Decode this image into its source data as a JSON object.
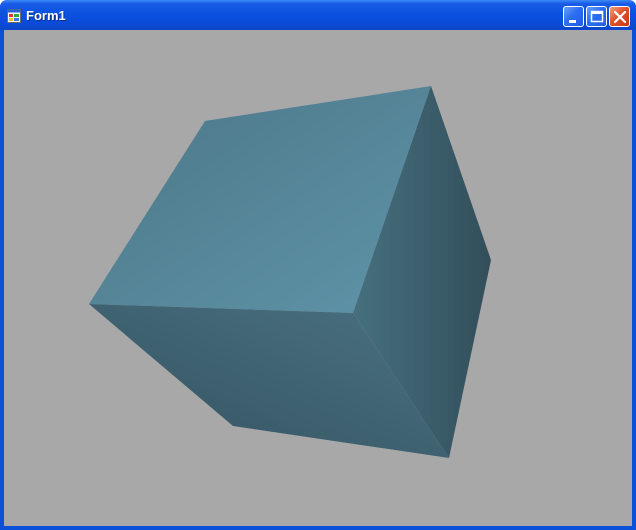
{
  "window": {
    "title": "Form1",
    "icon": "app-form-icon",
    "buttons": {
      "minimize": "minimize-icon",
      "maximize": "maximize-icon",
      "close": "close-icon"
    }
  },
  "colors": {
    "titlebar": "#0a4cdb",
    "client_background": "#a8a8a8",
    "cube_top_light": "#5f94a8",
    "cube_top_dark": "#4c7688",
    "cube_right_light": "#46707f",
    "cube_right_dark": "#324e5a",
    "cube_front_light": "#4a7282",
    "cube_front_dark": "#345260"
  },
  "scene": {
    "object": "3d-cube"
  }
}
